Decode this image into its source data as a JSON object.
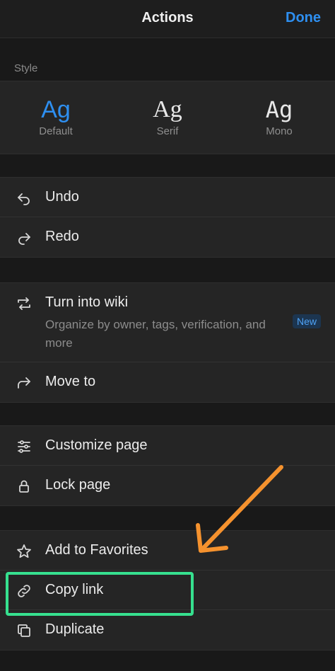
{
  "header": {
    "title": "Actions",
    "done_label": "Done"
  },
  "style_section": {
    "label": "Style",
    "options": [
      {
        "glyph": "Ag",
        "name": "Default"
      },
      {
        "glyph": "Ag",
        "name": "Serif"
      },
      {
        "glyph": "Ag",
        "name": "Mono"
      }
    ],
    "selected": "Default"
  },
  "history": {
    "undo": "Undo",
    "redo": "Redo"
  },
  "wiki": {
    "turn_into_wiki": "Turn into wiki",
    "subtitle": "Organize by owner, tags, verification, and more",
    "badge": "New",
    "move_to": "Move to"
  },
  "page_opts": {
    "customize": "Customize page",
    "lock": "Lock page"
  },
  "share": {
    "favorites": "Add to Favorites",
    "copy_link": "Copy link",
    "duplicate": "Duplicate"
  },
  "colors": {
    "accent": "#2e8ff0",
    "highlight": "#36e08f",
    "arrow": "#f5922e",
    "background": "#191919",
    "panel": "#252525"
  }
}
